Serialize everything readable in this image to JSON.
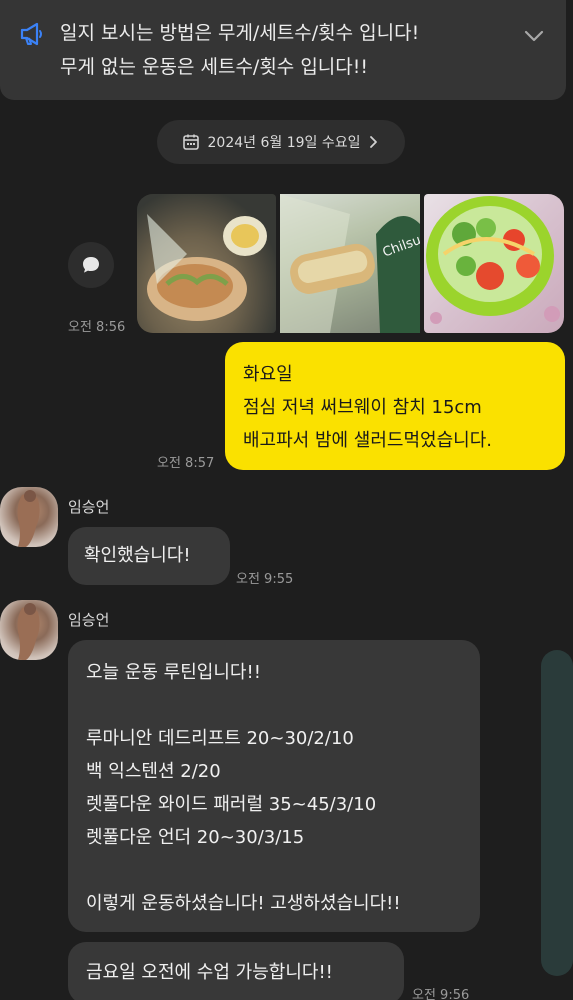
{
  "notice": {
    "line1": "일지 보시는 방법은 무게/세트수/횟수 입니다!",
    "line2": "무게 없는 운동은 세트수/횟수 입니다!!"
  },
  "date_separator": {
    "label": "2024년 6월 19일 수요일"
  },
  "photo_message": {
    "time": "오전 8:56"
  },
  "my_message": {
    "lines": [
      "화요일",
      "점심 저녁 써브웨이 참치 15cm",
      "배고파서 밤에 샐러드먹었습니다."
    ],
    "time": "오전 8:57"
  },
  "reply1": {
    "sender": "임승언",
    "text": "확인했습니다!",
    "time": "오전 9:55"
  },
  "reply2": {
    "sender": "임승언",
    "lines": [
      "오늘 운동 루틴입니다!!",
      "",
      "루마니안 데드리프트 20~30/2/10",
      "백 익스텐션 2/20",
      "렛풀다운 와이드 패러럴 35~45/3/10",
      "렛풀다운 언더 20~30/3/15",
      "",
      "이렇게 운동하셨습니다! 고생하셨습니다!!"
    ]
  },
  "reply3": {
    "text": "금요일 오전에 수업 가능합니다!!",
    "time": "오전 9:56"
  },
  "colors": {
    "background": "#1e1e1e",
    "my_bubble": "#fae100",
    "their_bubble": "#383838",
    "notice_accent": "#3b82f6"
  }
}
